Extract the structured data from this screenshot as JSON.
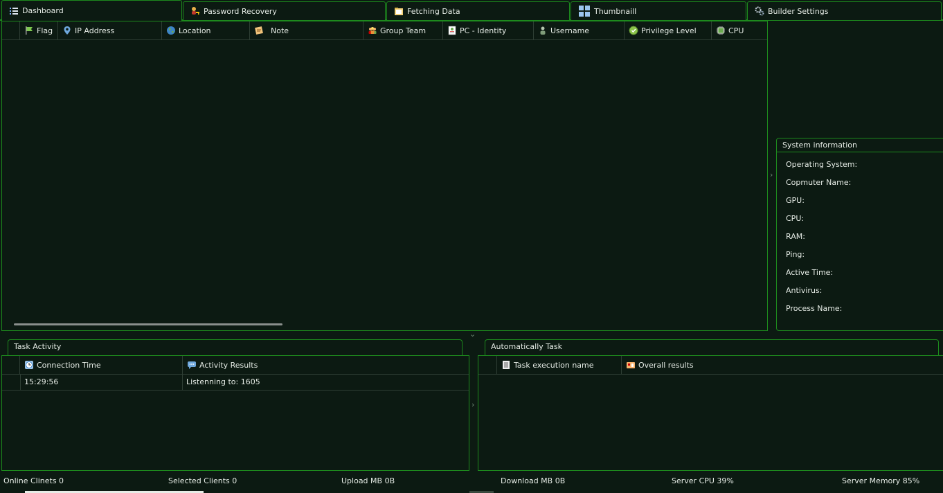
{
  "tabs": [
    {
      "label": "Dashboard",
      "icon": "list-icon",
      "active": true
    },
    {
      "label": "Password Recovery",
      "icon": "key-user-icon"
    },
    {
      "label": "Fetching Data",
      "icon": "folder-icon"
    },
    {
      "label": "ThumbnailI",
      "icon": "tiles-icon"
    },
    {
      "label": "Builder Settings",
      "icon": "gears-icon"
    }
  ],
  "clients_table": {
    "columns": [
      "Flag",
      "IP Address",
      "Location",
      "Note",
      "Group Team",
      "PC - Identity",
      "Username",
      "Privilege Level",
      "CPU"
    ],
    "rows": []
  },
  "system_info": {
    "title": "System information",
    "fields": [
      "Operating System:",
      "Copmuter Name:",
      "GPU:",
      "CPU:",
      "RAM:",
      "Ping:",
      "Active Time:",
      "Antivirus:",
      "Process Name:"
    ]
  },
  "task_activity": {
    "title": "Task Activity",
    "columns": [
      "Connection Time",
      "Activity  Results"
    ],
    "rows": [
      [
        "15:29:56",
        "Listenning to: 1605"
      ]
    ]
  },
  "auto_task": {
    "title": "Automatically Task",
    "columns": [
      "Task execution  name",
      "Overall results"
    ],
    "rows": []
  },
  "status_bar": {
    "online": "Online Clinets 0",
    "selected": "Selected Clients 0",
    "upload": "Upload MB 0B",
    "download": "Download MB  0B",
    "server_cpu": "Server CPU 39%",
    "server_memory": "Server Memory 85%"
  },
  "colors": {
    "accent": "#1d8a1d",
    "background": "#0c1a12",
    "text": "#e6ece6"
  }
}
